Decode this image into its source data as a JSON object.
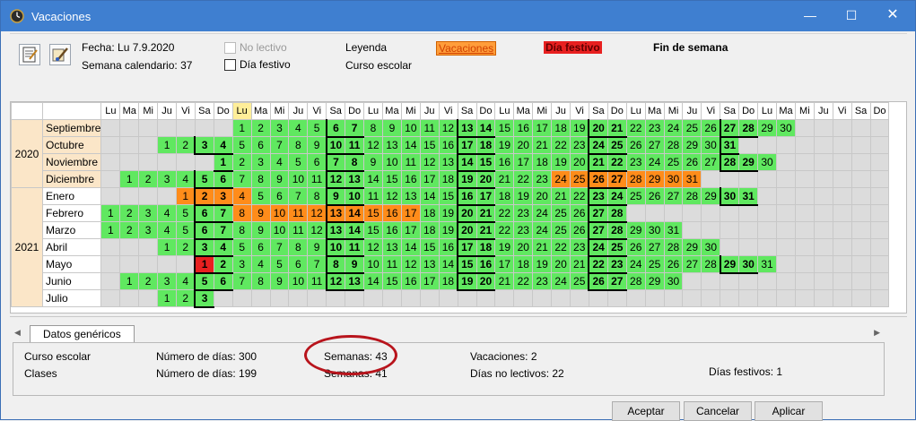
{
  "window": {
    "title": "Vacaciones"
  },
  "info": {
    "fecha": "Fecha: Lu 7.9.2020",
    "semana": "Semana calendario: 37",
    "no_lectivo": "No lectivo",
    "dia_festivo": "Día festivo",
    "leyenda": "Leyenda",
    "curso_escolar": "Curso escolar"
  },
  "legend": {
    "vacaciones": "Vacaciones",
    "dia_festivo": "Día festivo",
    "fin_semana": "Fin de semana",
    "colors": {
      "vacaciones": "#ff8c1a",
      "festivo": "#e82020",
      "lectivo": "#60e860",
      "empty": "#dcdcdc"
    }
  },
  "calendar": {
    "weekday_headers": [
      "Lu",
      "Ma",
      "Mi",
      "Ju",
      "Vi",
      "Sa",
      "Do",
      "Lu",
      "Ma",
      "Mi",
      "Ju",
      "Vi",
      "Sa",
      "Do",
      "Lu",
      "Ma",
      "Mi",
      "Ju",
      "Vi",
      "Sa",
      "Do",
      "Lu",
      "Ma",
      "Mi",
      "Ju",
      "Vi",
      "Sa",
      "Do",
      "Lu",
      "Ma",
      "Mi",
      "Ju",
      "Vi",
      "Sa",
      "Do",
      "Lu",
      "Ma",
      "Mi",
      "Ju",
      "Vi",
      "Sa",
      "Do"
    ],
    "today_column": 7,
    "months": [
      {
        "year": "2020",
        "name": "Septiembre",
        "offset": 7,
        "days": 30,
        "vac": [],
        "hol": []
      },
      {
        "year": "2020",
        "name": "Octubre",
        "offset": 3,
        "days": 31,
        "vac": [],
        "hol": []
      },
      {
        "year": "2020",
        "name": "Noviembre",
        "offset": 6,
        "days": 30,
        "vac": [],
        "hol": []
      },
      {
        "year": "2020",
        "name": "Diciembre",
        "offset": 1,
        "days": 31,
        "vac": [
          24,
          25,
          26,
          27,
          28,
          29,
          30,
          31
        ],
        "hol": []
      },
      {
        "year": "2021",
        "name": "Enero",
        "offset": 4,
        "days": 31,
        "vac": [
          1,
          2,
          3,
          4
        ],
        "hol": []
      },
      {
        "year": "2021",
        "name": "Febrero",
        "offset": 0,
        "days": 28,
        "vac": [
          8,
          9,
          10,
          11,
          12,
          13,
          14,
          15,
          16,
          17
        ],
        "hol": []
      },
      {
        "year": "2021",
        "name": "Marzo",
        "offset": 0,
        "days": 31,
        "vac": [],
        "hol": []
      },
      {
        "year": "2021",
        "name": "Abril",
        "offset": 3,
        "days": 30,
        "vac": [],
        "hol": []
      },
      {
        "year": "2021",
        "name": "Mayo",
        "offset": 5,
        "days": 31,
        "vac": [],
        "hol": [
          1
        ]
      },
      {
        "year": "2021",
        "name": "Junio",
        "offset": 1,
        "days": 30,
        "vac": [],
        "hol": []
      },
      {
        "year": "2021",
        "name": "Julio",
        "offset": 3,
        "days": 3,
        "vac": [],
        "hol": []
      }
    ]
  },
  "tabs": {
    "datos": "Datos genéricos"
  },
  "stats": {
    "curso_escolar": "Curso escolar",
    "clases": "Clases",
    "num_dias_curso": "Número de días: 300",
    "num_dias_clases": "Número de días: 199",
    "semanas_curso": "Semanas: 43",
    "semanas_clases": "Semanas: 41",
    "vacaciones": "Vacaciones: 2",
    "dias_no_lectivos": "Días no lectivos: 22",
    "dias_festivos": "Días festivos: 1"
  },
  "buttons": {
    "aceptar": "Aceptar",
    "cancelar": "Cancelar",
    "aplicar": "Aplicar"
  }
}
